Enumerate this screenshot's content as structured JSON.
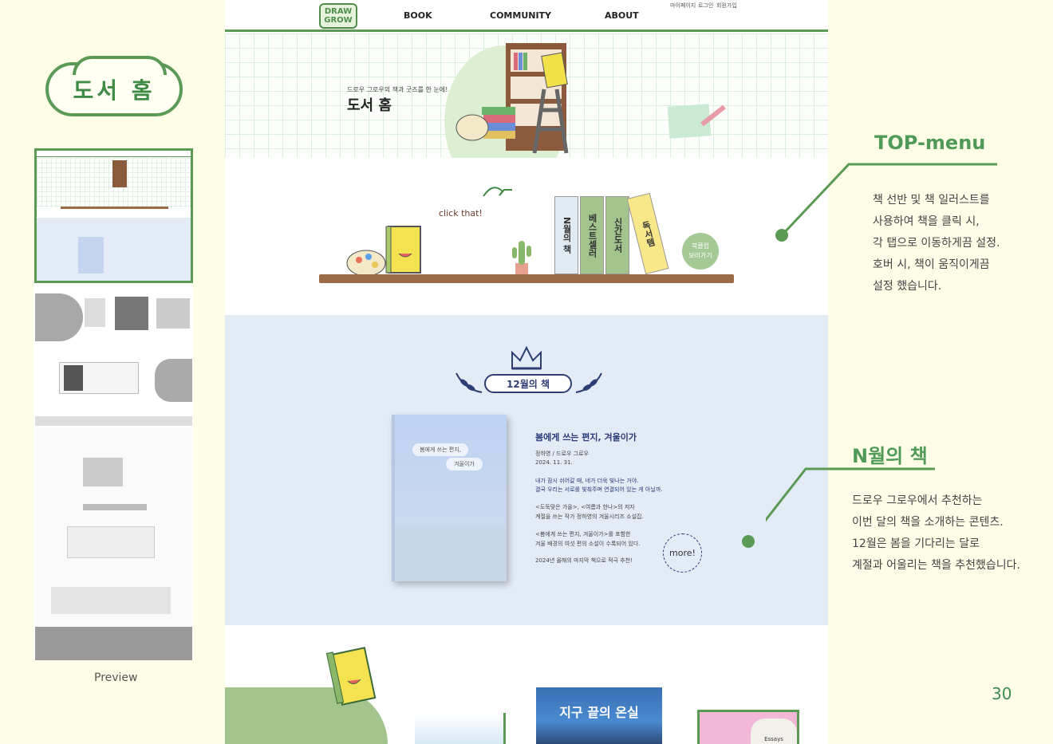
{
  "left": {
    "badge": "도서 홈",
    "preview_label": "Preview"
  },
  "nav": {
    "logo": "DRAW GROW",
    "links": [
      "BOOK",
      "COMMUNITY",
      "ABOUT"
    ],
    "util": [
      "마이페이지",
      "로그인",
      "회원가입"
    ]
  },
  "hero": {
    "subtitle": "드로우 그로우의 책과 굿즈를 한 눈에!",
    "title": "도서 홈"
  },
  "shelf": {
    "click_text": "click that!",
    "books": [
      "N월의 책",
      "베스트셀러",
      "신간도서",
      "독서템"
    ],
    "club_button": "북클럽\n보러가기"
  },
  "month": {
    "tag": "12월의 책",
    "cover_title1": "봄에게 쓰는 편지,",
    "cover_title2": "겨울이가",
    "book_title": "봄에게 쓰는 편지, 겨울이가",
    "author": "정하영 / 드로우 그로우",
    "date": "2024. 11. 31.",
    "desc1": "내가 잠시 쉬어갈 때, 네가 더욱 빛나는 거야.",
    "desc2": "결국 우리는 서로를 빛춰주며 연결되어 있는 게 아닐까.",
    "desc3": "<도둑맞은 가을>, <여름과 한나>의 저자",
    "desc4": "계절을 쓰는 작가 정하영의 겨울시리즈 소설집.",
    "desc5": "<봄에게 쓰는 편지, 겨울이가>를 포함한",
    "desc6": "겨울 배경의 여섯 편의 소설이 수록되어 있다.",
    "desc7": "2024년 올해의 마지막 책으로 적극 추천!",
    "more": "more!"
  },
  "bottom": {
    "book2_title": "지구 끝의 온실",
    "book3_label": "Essays"
  },
  "annotations": {
    "top_title": "TOP-menu",
    "top_lines": [
      "책 선반 및 책 일러스트를",
      "사용하여 책을 클릭 시,",
      "각 탭으로 이동하게끔 설정.",
      "호버 시, 책이 움직이게끔",
      "설정 했습니다."
    ],
    "n_title": "N월의 책",
    "n_lines": [
      "드로우 그로우에서 추천하는",
      "이번 달의 책을 소개하는 콘텐츠.",
      "12월은 봄을 기다리는 달로",
      "계절과 어울리는 책을 추천했습니다."
    ],
    "page_number": "30"
  }
}
